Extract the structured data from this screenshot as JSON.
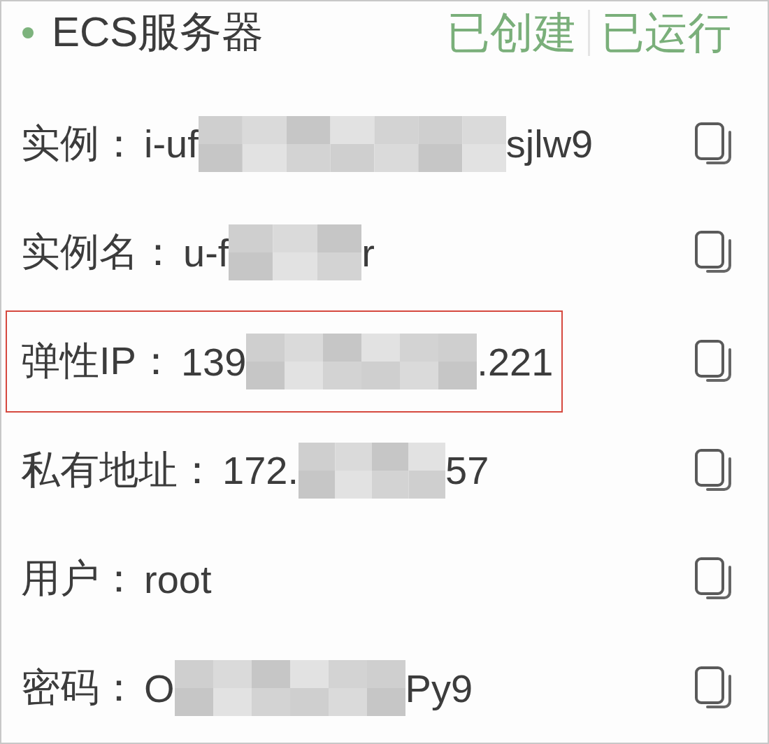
{
  "header": {
    "title": "ECS服务器",
    "statuses": [
      "已创建",
      "已运行"
    ]
  },
  "rows": [
    {
      "label": "实例：",
      "value_start": "i-uf",
      "value_end": "sjlw9",
      "masked": true,
      "highlighted": false
    },
    {
      "label": "实例名：",
      "value_start": "u-f",
      "value_end": "r",
      "masked": true,
      "highlighted": false
    },
    {
      "label": "弹性IP：",
      "value_start": "139",
      "value_end": ".221",
      "masked": true,
      "highlighted": true
    },
    {
      "label": "私有地址：",
      "value_start": "172.",
      "value_end": "57",
      "masked": true,
      "highlighted": false
    },
    {
      "label": "用户：",
      "value_start": "root",
      "masked": false,
      "highlighted": false
    },
    {
      "label": "密码：",
      "value_start": "O",
      "value_end": "Py9",
      "masked": true,
      "highlighted": false
    }
  ]
}
